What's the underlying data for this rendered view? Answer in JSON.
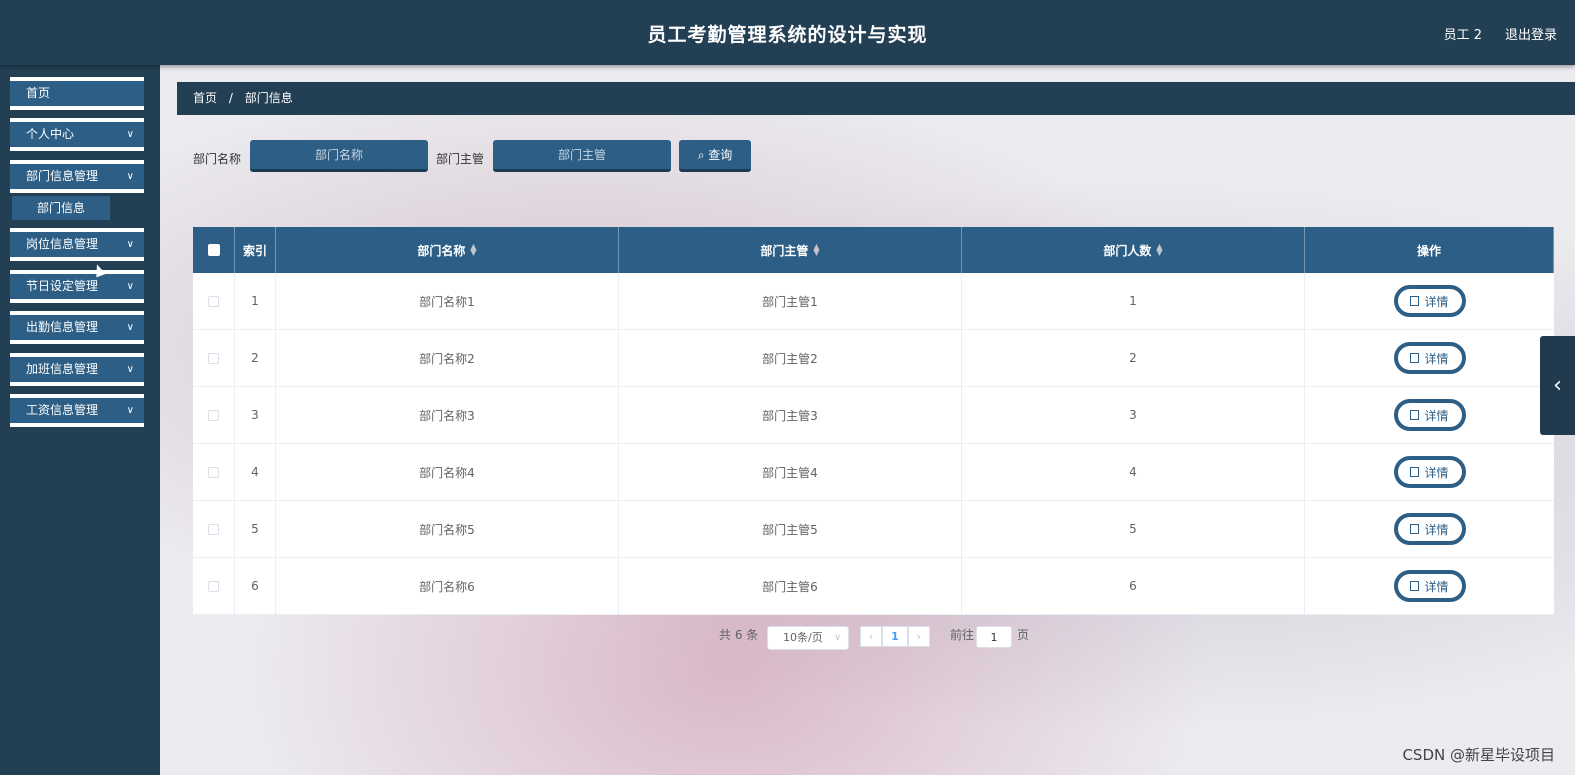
{
  "header": {
    "title": "员工考勤管理系统的设计与实现",
    "user": "员工 2",
    "logout": "退出登录"
  },
  "sidebar": {
    "items": [
      {
        "label": "首页",
        "has_arrow": false
      },
      {
        "label": "个人中心",
        "has_arrow": true
      },
      {
        "label": "部门信息管理",
        "has_arrow": true
      },
      {
        "label": "岗位信息管理",
        "has_arrow": true
      },
      {
        "label": "节日设定管理",
        "has_arrow": true
      },
      {
        "label": "出勤信息管理",
        "has_arrow": true
      },
      {
        "label": "加班信息管理",
        "has_arrow": true
      },
      {
        "label": "工资信息管理",
        "has_arrow": true
      }
    ],
    "sub_item": "部门信息"
  },
  "breadcrumb": {
    "home": "首页",
    "current": "部门信息",
    "separator": "/"
  },
  "search": {
    "name_label": "部门名称",
    "name_placeholder": "部门名称",
    "manager_label": "部门主管",
    "manager_placeholder": "部门主管",
    "button": "查询"
  },
  "table": {
    "headers": {
      "index": "索引",
      "name": "部门名称",
      "manager": "部门主管",
      "count": "部门人数",
      "actions": "操作"
    },
    "rows": [
      {
        "index": "1",
        "name": "部门名称1",
        "manager": "部门主管1",
        "count": "1",
        "action": "详情"
      },
      {
        "index": "2",
        "name": "部门名称2",
        "manager": "部门主管2",
        "count": "2",
        "action": "详情"
      },
      {
        "index": "3",
        "name": "部门名称3",
        "manager": "部门主管3",
        "count": "3",
        "action": "详情"
      },
      {
        "index": "4",
        "name": "部门名称4",
        "manager": "部门主管4",
        "count": "4",
        "action": "详情"
      },
      {
        "index": "5",
        "name": "部门名称5",
        "manager": "部门主管5",
        "count": "5",
        "action": "详情"
      },
      {
        "index": "6",
        "name": "部门名称6",
        "manager": "部门主管6",
        "count": "6",
        "action": "详情"
      }
    ]
  },
  "pagination": {
    "total": "共 6 条",
    "page_size": "10条/页",
    "current_page": "1",
    "goto_label": "前往",
    "goto_value": "1",
    "page_suffix": "页"
  },
  "watermark": "CSDN @新星毕设项目",
  "colors": {
    "header_bg": "#233f54",
    "accent": "#2d5e85",
    "active_page": "#409eff"
  }
}
